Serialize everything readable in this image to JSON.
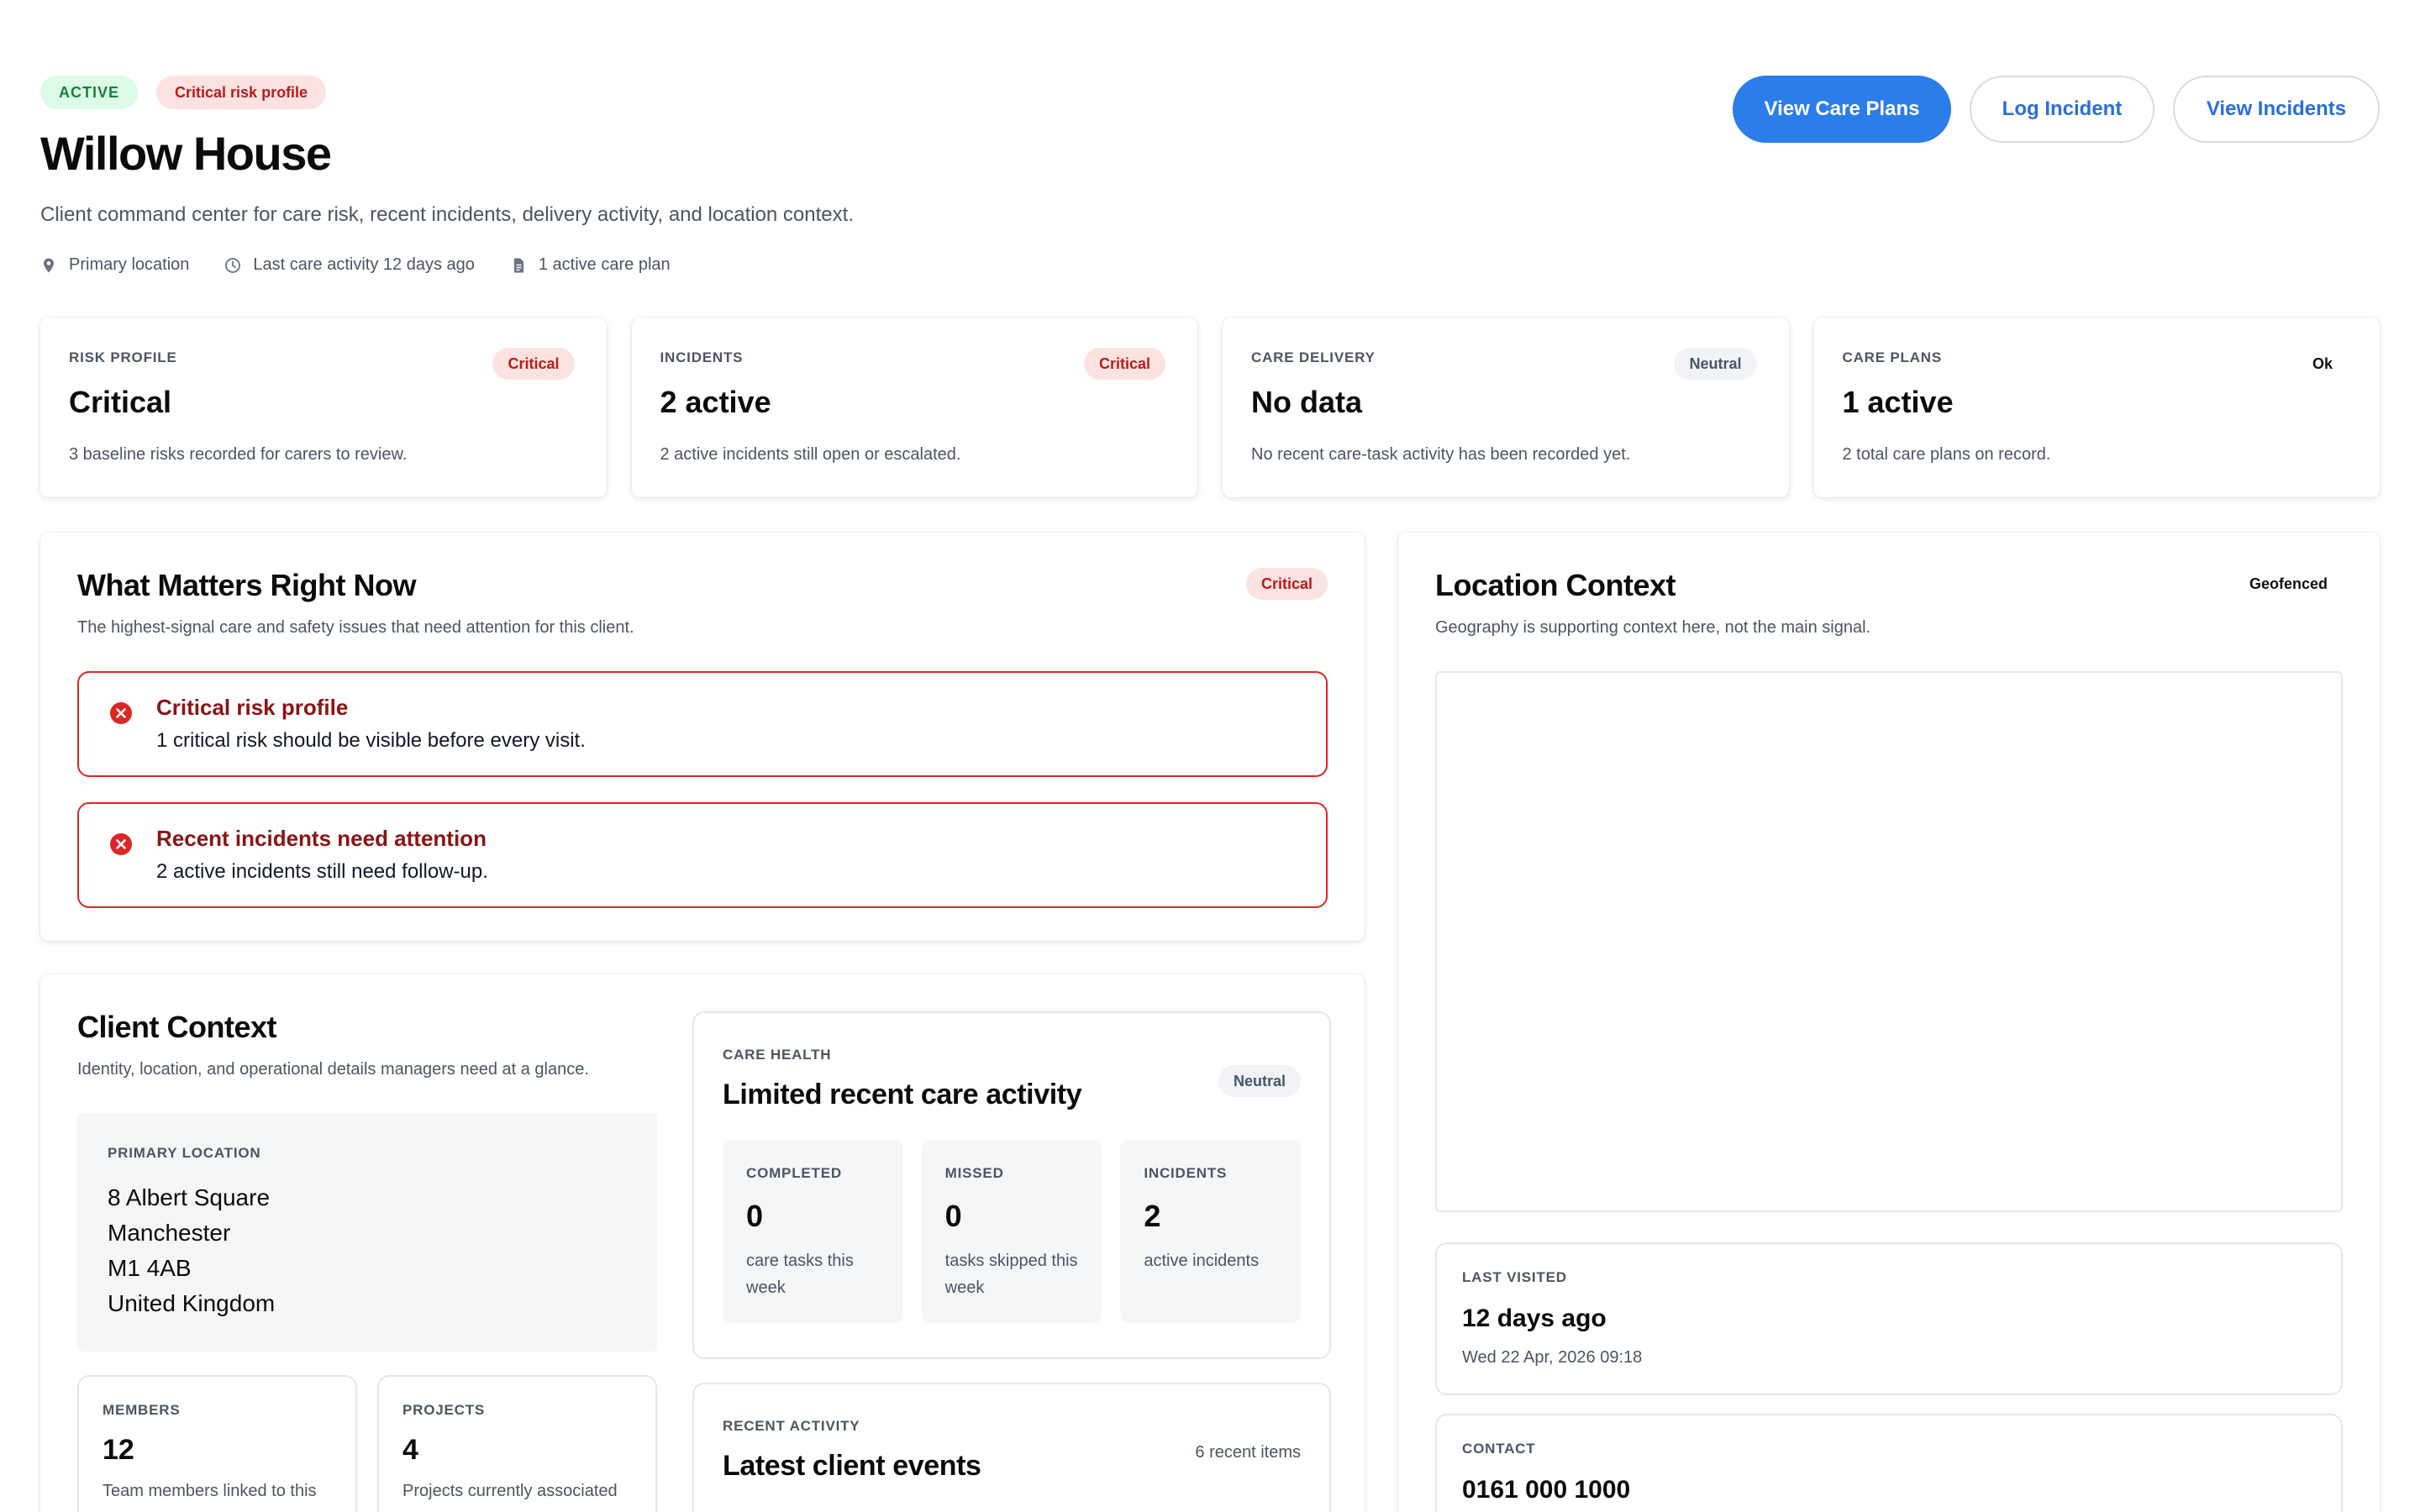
{
  "header": {
    "status_badge": "ACTIVE",
    "risk_badge": "Critical risk profile",
    "title": "Willow House",
    "subtitle": "Client command center for care risk, recent incidents, delivery activity, and location context.",
    "meta": {
      "location": "Primary location",
      "last_activity": "Last care activity 12 days ago",
      "care_plans": "1 active care plan"
    },
    "actions": {
      "view_care_plans": "View Care Plans",
      "log_incident": "Log Incident",
      "view_incidents": "View Incidents"
    }
  },
  "stats": [
    {
      "label": "RISK PROFILE",
      "badge": "Critical",
      "value": "Critical",
      "desc": "3 baseline risks recorded for carers to review."
    },
    {
      "label": "INCIDENTS",
      "badge": "Critical",
      "value": "2 active",
      "desc": "2 active incidents still open or escalated."
    },
    {
      "label": "CARE DELIVERY",
      "badge": "Neutral",
      "value": "No data",
      "desc": "No recent care-task activity has been recorded yet."
    },
    {
      "label": "CARE PLANS",
      "badge": "Ok",
      "value": "1 active",
      "desc": "2 total care plans on record."
    }
  ],
  "matters": {
    "title": "What Matters Right Now",
    "badge": "Critical",
    "subtitle": "The highest-signal care and safety issues that need attention for this client.",
    "alerts": [
      {
        "title": "Critical risk profile",
        "text": "1 critical risk should be visible before every visit."
      },
      {
        "title": "Recent incidents need attention",
        "text": "2 active incidents still need follow-up."
      }
    ]
  },
  "location": {
    "title": "Location Context",
    "badge": "Geofenced",
    "subtitle": "Geography is supporting context here, not the main signal.",
    "last_visited": {
      "label": "LAST VISITED",
      "value": "12 days ago",
      "sub": "Wed 22 Apr, 2026 09:18"
    },
    "contact": {
      "label": "CONTACT",
      "value": "0161 000 1000"
    }
  },
  "client": {
    "title": "Client Context",
    "subtitle": "Identity, location, and operational details managers need at a glance.",
    "primary_location": {
      "label": "PRIMARY LOCATION",
      "lines": [
        "8 Albert Square",
        "Manchester",
        "M1 4AB",
        "United Kingdom"
      ]
    },
    "members": {
      "label": "MEMBERS",
      "value": "12",
      "desc": "Team members linked to this"
    },
    "projects": {
      "label": "PROJECTS",
      "value": "4",
      "desc": "Projects currently associated"
    }
  },
  "care_health": {
    "label": "CARE HEALTH",
    "title": "Limited recent care activity",
    "badge": "Neutral",
    "metrics": [
      {
        "label": "COMPLETED",
        "value": "0",
        "desc": "care tasks this week"
      },
      {
        "label": "MISSED",
        "value": "0",
        "desc": "tasks skipped this week"
      },
      {
        "label": "INCIDENTS",
        "value": "2",
        "desc": "active incidents"
      }
    ]
  },
  "recent_activity": {
    "label": "RECENT ACTIVITY",
    "title": "Latest client events",
    "count": "6 recent items"
  },
  "colors": {
    "accent": "#2b7de9",
    "critical": "#dc2626",
    "critical_bg": "#fde2e2",
    "ok_bg": "#dcfce7"
  }
}
